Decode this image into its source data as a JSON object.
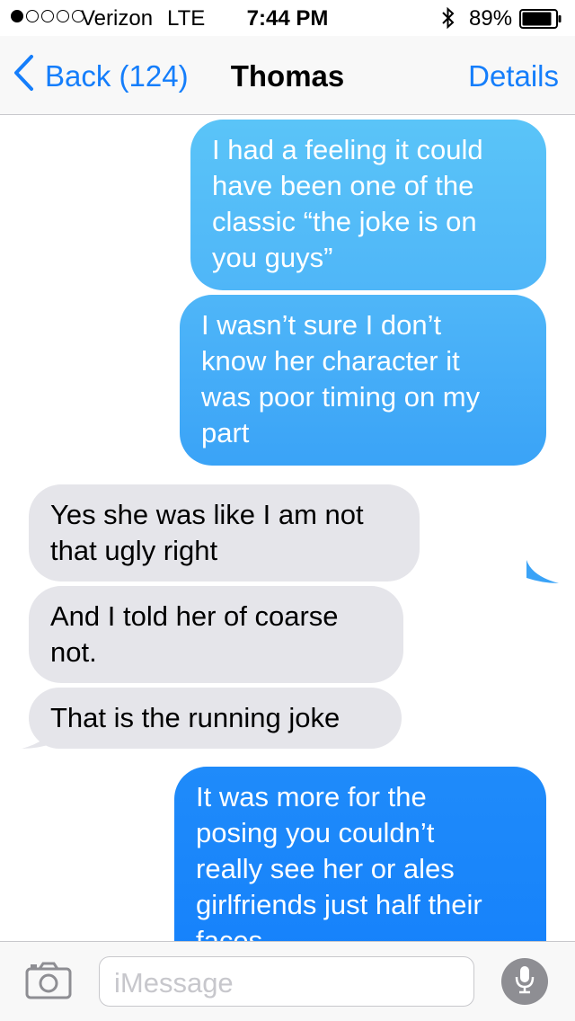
{
  "status_bar": {
    "signal_dots_filled": 1,
    "signal_dots_total": 5,
    "carrier": "Verizon",
    "network": "LTE",
    "time": "7:44 PM",
    "battery": "89%",
    "battery_level": 0.89
  },
  "nav": {
    "back_label": "Back (124)",
    "title": "Thomas",
    "details_label": "Details"
  },
  "messages": [
    {
      "direction": "outgoing",
      "text": "I had a feeling it could\nhave been one of the\nclassic “the joke is on\nyou guys”"
    },
    {
      "direction": "outgoing",
      "text": "I wasn’t sure I don’t\nknow her character it\nwas poor timing on my\npart"
    },
    {
      "direction": "incoming",
      "text": "Yes she was like I am not\nthat ugly right"
    },
    {
      "direction": "incoming",
      "text": "And I told her of coarse\nnot."
    },
    {
      "direction": "incoming",
      "text": "That is the running joke"
    },
    {
      "direction": "outgoing",
      "text": "It was more for the\nposing you couldn’t\nreally see her or ales\ngirlfriends just half their\nfaces"
    }
  ],
  "input": {
    "placeholder": "iMessage"
  },
  "icons": {
    "camera": "camera-icon",
    "mic": "microphone-icon",
    "back": "chevron-left-icon",
    "bluetooth": "bluetooth-icon",
    "battery": "battery-icon"
  },
  "colors": {
    "accent": "#157efb",
    "outgoing_top": "#5ac4f8",
    "outgoing_bottom": "#157efb",
    "incoming": "#e5e5ea"
  }
}
